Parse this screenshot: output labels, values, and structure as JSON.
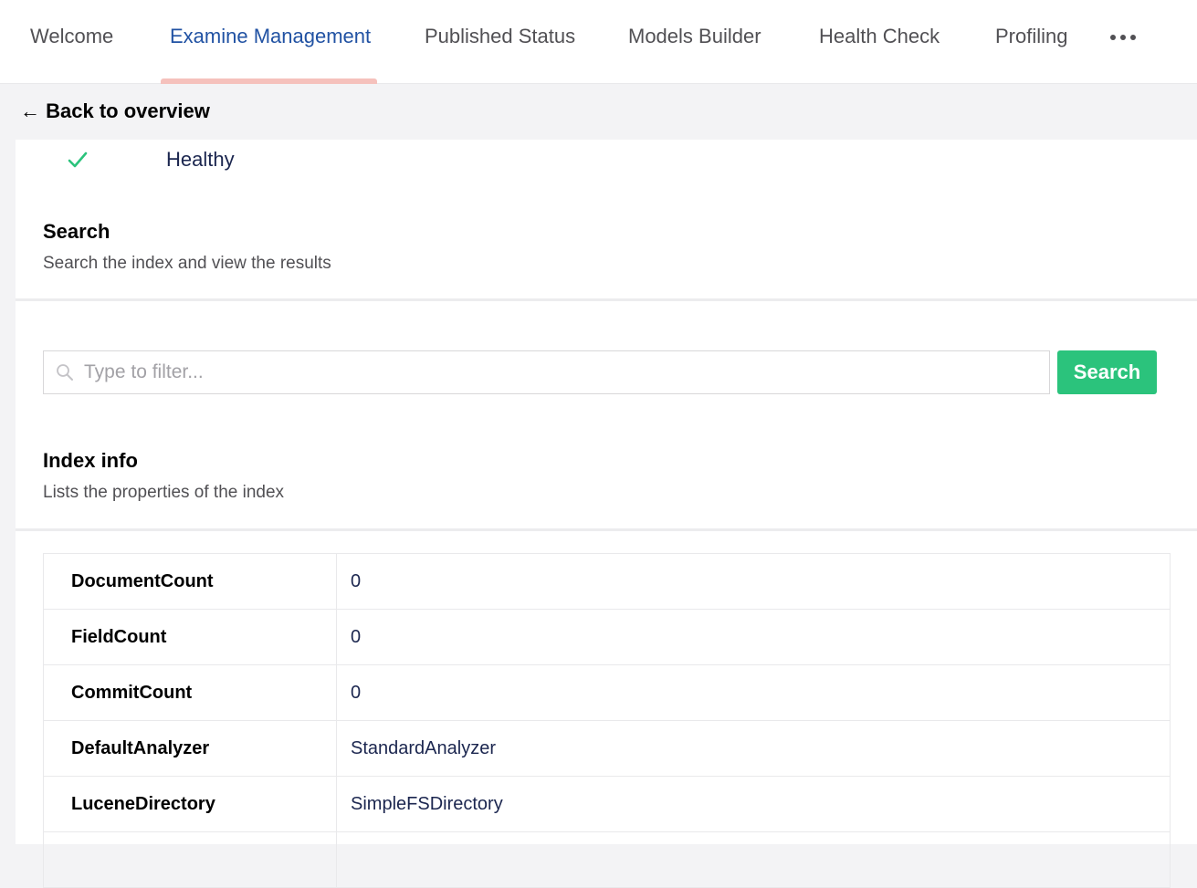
{
  "tabs": [
    {
      "label": "Welcome",
      "active": false
    },
    {
      "label": "Examine Management",
      "active": true
    },
    {
      "label": "Published Status",
      "active": false
    },
    {
      "label": "Models Builder",
      "active": false
    },
    {
      "label": "Health Check",
      "active": false
    },
    {
      "label": "Profiling",
      "active": false
    }
  ],
  "more_icon": "ellipsis-icon",
  "back_link": "← Back to overview",
  "status": {
    "icon": "check-icon",
    "text": "Healthy",
    "color": "#2bc37c"
  },
  "search_section": {
    "title": "Search",
    "description": "Search the index and view the results",
    "input_value": "",
    "placeholder": "Type to filter...",
    "button_label": "Search"
  },
  "index_info": {
    "title": "Index info",
    "description": "Lists the properties of the index",
    "rows": [
      {
        "key": "DocumentCount",
        "value": "0"
      },
      {
        "key": "FieldCount",
        "value": "0"
      },
      {
        "key": "CommitCount",
        "value": "0"
      },
      {
        "key": "DefaultAnalyzer",
        "value": "StandardAnalyzer"
      },
      {
        "key": "LuceneDirectory",
        "value": "SimpleFSDirectory"
      },
      {
        "key": "",
        "value": ""
      }
    ]
  },
  "colors": {
    "accent": "#2152a3",
    "primary_button": "#2bc37c",
    "tab_indicator": "#f5c1bc"
  }
}
